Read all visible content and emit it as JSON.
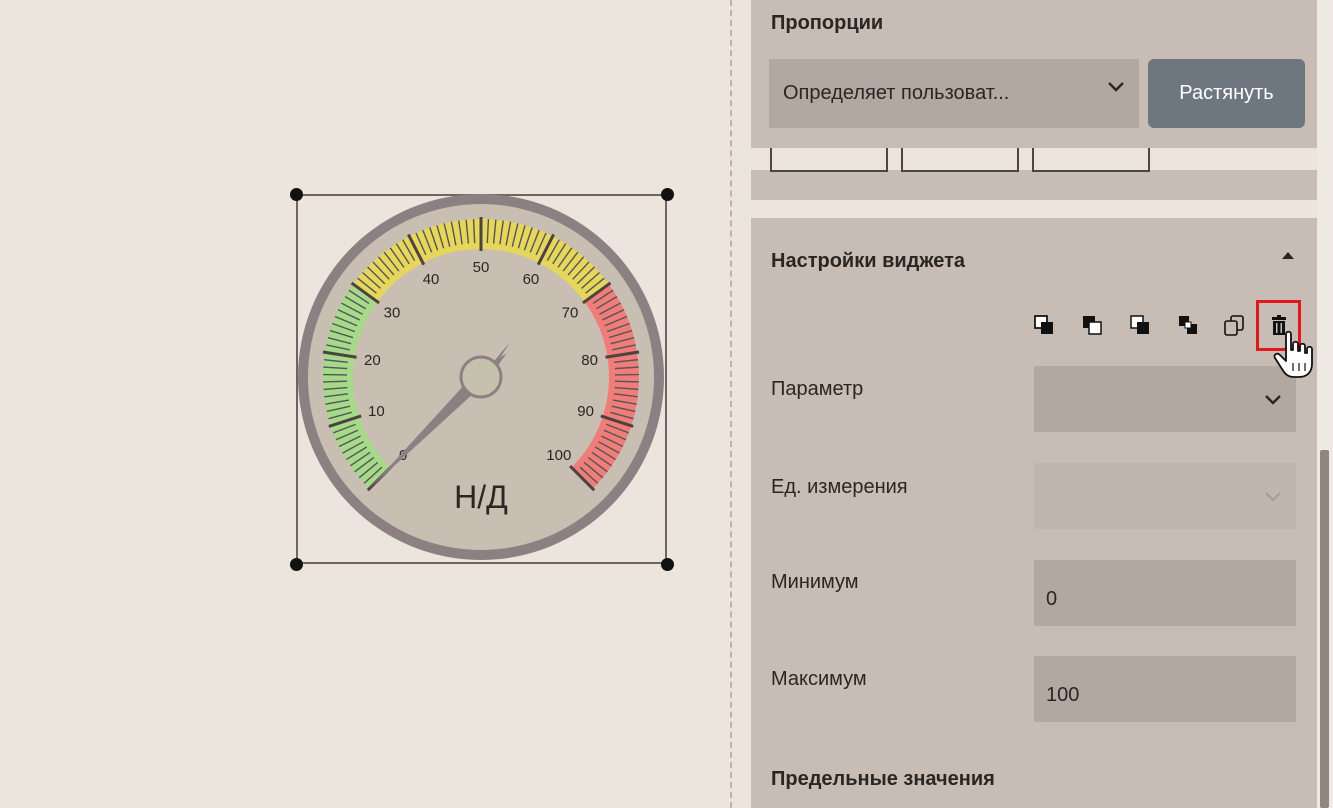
{
  "proportions": {
    "title": "Пропорции",
    "select_value": "Определяет пользоват...",
    "stretch_label": "Растянуть"
  },
  "widget_settings": {
    "title": "Настройки виджета",
    "toolbar": [
      "send-to-back-icon",
      "send-backward-icon",
      "bring-forward-icon",
      "bring-to-front-icon",
      "duplicate-icon",
      "trash-icon"
    ],
    "fields": {
      "parameter": {
        "label": "Параметр",
        "value": ""
      },
      "unit": {
        "label": "Ед. измерения",
        "value": ""
      },
      "minimum": {
        "label": "Минимум",
        "value": "0"
      },
      "maximum": {
        "label": "Максимум",
        "value": "100"
      }
    },
    "limits_title": "Предельные значения"
  },
  "gauge": {
    "value_text": "Н/Д",
    "min": 0,
    "max": 100,
    "needle_value": 0,
    "ticks": [
      "0",
      "10",
      "20",
      "30",
      "40",
      "50",
      "60",
      "70",
      "80",
      "90",
      "100"
    ],
    "zones": [
      {
        "from": 0,
        "to": 30,
        "color": "#a6d98a"
      },
      {
        "from": 30,
        "to": 70,
        "color": "#e6d65c"
      },
      {
        "from": 70,
        "to": 100,
        "color": "#f07d7a"
      }
    ],
    "colors": {
      "rim": "#8d8082",
      "face": "#c8bfb2",
      "needle": "#8d8082",
      "hub": "#c6c1ad"
    }
  },
  "colors": {
    "accent_delete": "#e01a1a",
    "button": "#6e7780"
  }
}
